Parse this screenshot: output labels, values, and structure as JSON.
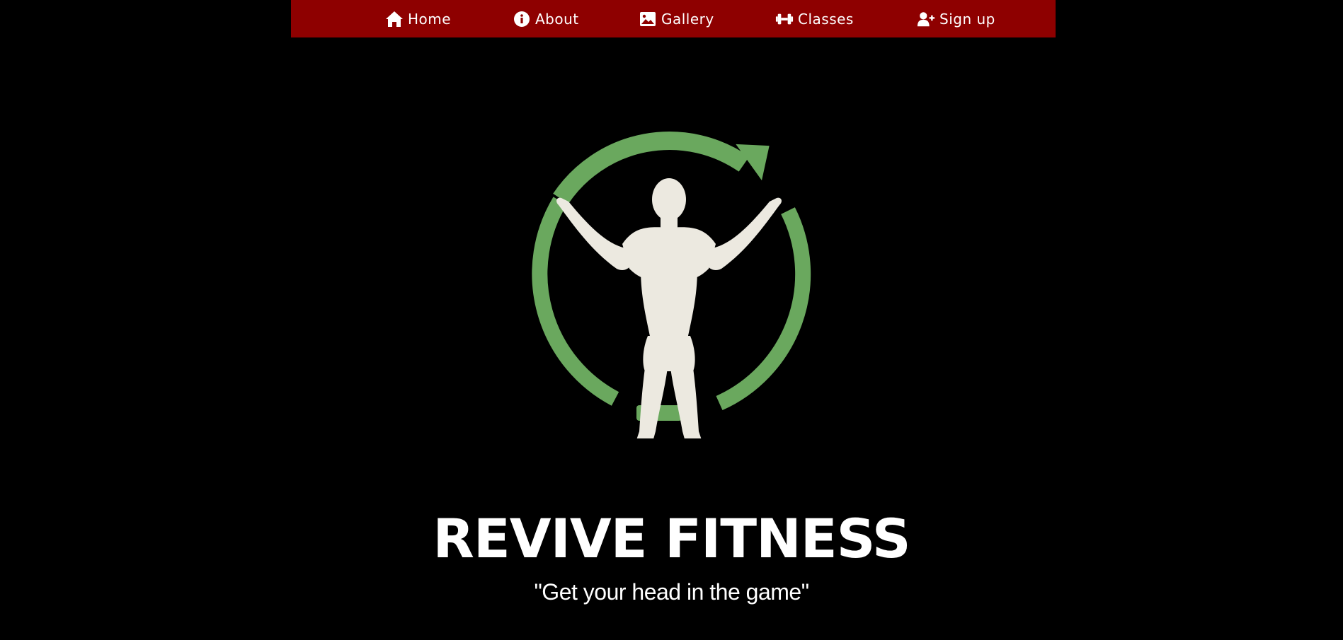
{
  "nav": {
    "items": [
      {
        "label": "Home",
        "icon": "home-icon"
      },
      {
        "label": "About",
        "icon": "info-icon"
      },
      {
        "label": "Gallery",
        "icon": "image-icon"
      },
      {
        "label": "Classes",
        "icon": "dumbbell-icon"
      },
      {
        "label": "Sign up",
        "icon": "user-plus-icon"
      }
    ]
  },
  "hero": {
    "title": "REVIVE FITNESS",
    "tagline": "\"Get your head in the game\""
  },
  "colors": {
    "nav_background": "#8e0000",
    "page_background": "#000000",
    "logo_ring": "#6aa85e",
    "logo_figure": "#ece9e0"
  }
}
